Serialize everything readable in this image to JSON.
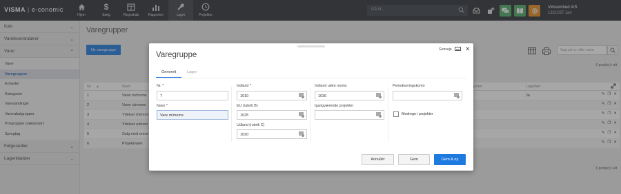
{
  "app": {
    "brand": "VISMA",
    "product": "e-conomic"
  },
  "nav": [
    {
      "label": "Hjem",
      "icon": "home-icon"
    },
    {
      "label": "Sælg",
      "icon": "dollar-icon"
    },
    {
      "label": "Regnskab",
      "icon": "ledger-icon"
    },
    {
      "label": "Rapporter",
      "icon": "bar-chart-icon"
    },
    {
      "label": "Lager",
      "icon": "tools-icon"
    },
    {
      "label": "Projekter",
      "icon": "clock-icon"
    }
  ],
  "search": {
    "placeholder": "Gå til..."
  },
  "company": {
    "name": "Virksomhed A/S",
    "user": "1321037 Jan"
  },
  "sidebar": {
    "groups": [
      {
        "label": "Køb"
      },
      {
        "label": "Vareleverandører"
      },
      {
        "label": "Varer"
      },
      {
        "label": "Følgesedler"
      },
      {
        "label": "Lagerkladder"
      }
    ],
    "items": [
      {
        "label": "Varer"
      },
      {
        "label": "Varegrupper"
      },
      {
        "label": "Enheder"
      },
      {
        "label": "Kategorier"
      },
      {
        "label": "Varesamlinger"
      },
      {
        "label": "Varerabatgrupper"
      },
      {
        "label": "Prisgrupper (særpriser)"
      },
      {
        "label": "Sprogtag"
      }
    ]
  },
  "main": {
    "title": "Varegrupper",
    "new_button": "Ny varegruppe",
    "search_placeholder": "Søg på nr. eller navn",
    "count_top": "6 post(er) i alt",
    "count_bottom": "6 post(er) i alt",
    "columns": {
      "nr": "Nr.",
      "navn": "Navn",
      "col3": "...projekter",
      "lagerfoert": "Lagerført"
    },
    "rows": [
      {
        "nr": "1",
        "navn": "Varer m/moms",
        "lager": "Ja"
      },
      {
        "nr": "2",
        "navn": "Varer u/moms",
        "lager": ""
      },
      {
        "nr": "3",
        "navn": "Ydelser m/mom",
        "lager": ""
      },
      {
        "nr": "4",
        "navn": "Ydelser u/mom",
        "lager": ""
      },
      {
        "nr": "5",
        "navn": "Salg med omve",
        "lager": ""
      },
      {
        "nr": "6",
        "navn": "Projektvarer",
        "lager": ""
      }
    ]
  },
  "modal": {
    "title": "Varegruppe",
    "shortcuts": "Genveje",
    "tabs": [
      "Generelt",
      "Lager"
    ],
    "fields": {
      "nr_label": "Nr. *",
      "nr_value": "7",
      "navn_label": "Navn *",
      "navn_value": "Vare m/moms",
      "indland_label": "Indland *",
      "indland_value": "1010",
      "eu_label": "EU (rubrik B)",
      "eu_value": "1025",
      "udland_label": "Udland (rubrik C)",
      "udland_value": "1020",
      "indland_uden_moms_label": "Indland uden moms",
      "indland_uden_moms_value": "1030",
      "igangvaerende_label": "Igangværende projekter",
      "igangvaerende_value": "",
      "periodisering_label": "Periodiseringskonto",
      "periodisering_value": "",
      "medregn_label": "Medregn i projekter"
    },
    "buttons": {
      "cancel": "Annullér",
      "save": "Gem",
      "save_new": "Gem & ny"
    }
  },
  "colors": {
    "accent": "#1f7ae0",
    "topbar": "#2b2e33"
  }
}
